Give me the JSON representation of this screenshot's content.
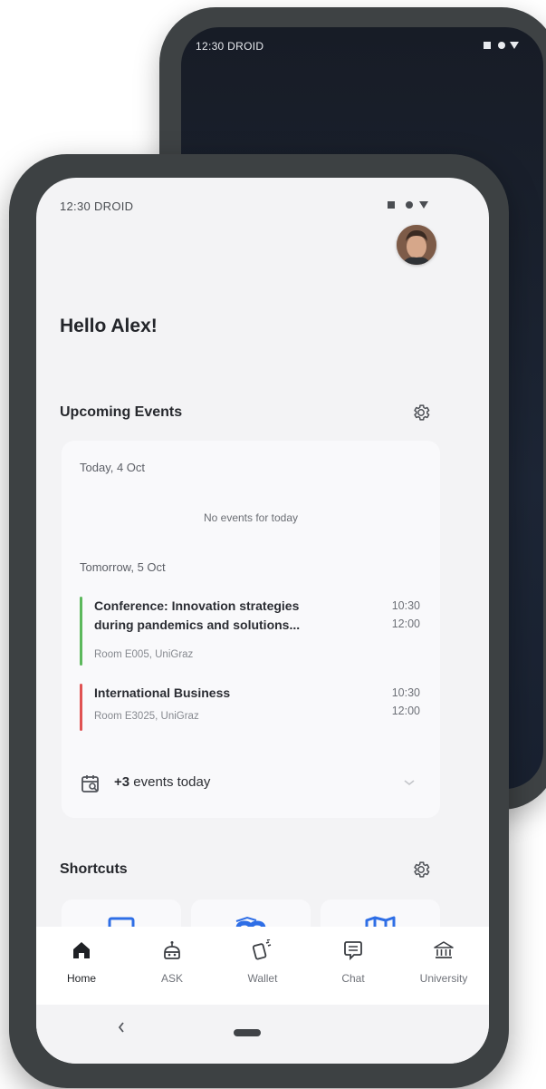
{
  "back_phone": {
    "time": "12:30 DROID"
  },
  "status_bar": {
    "time": "12:30 DROID"
  },
  "greeting": "Hello Alex!",
  "upcoming_events": {
    "title": "Upcoming Events",
    "today_label": "Today, 4 Oct",
    "no_events": "No events for today",
    "tomorrow_label": "Tomorrow, 5 Oct",
    "events": [
      {
        "title_line1": "Conference: Innovation strategies",
        "title_line2": "during pandemics and solutions...",
        "room": "Room E005, UniGraz",
        "start": "10:30",
        "end": "12:00",
        "color": "#5cb85c"
      },
      {
        "title_line1": "International Business",
        "room": "Room E3025, UniGraz",
        "start": "10:30",
        "end": "12:00",
        "color": "#e05252"
      }
    ],
    "more_count": "+3",
    "more_text": " events today"
  },
  "shortcuts": {
    "title": "Shortcuts"
  },
  "bottom_nav": {
    "items": [
      {
        "label": "Home",
        "icon": "home-icon",
        "active": true
      },
      {
        "label": "ASK",
        "icon": "robot-icon"
      },
      {
        "label": "Wallet",
        "icon": "wallet-cards-icon"
      },
      {
        "label": "Chat",
        "icon": "chat-icon"
      },
      {
        "label": "University",
        "icon": "university-icon"
      }
    ]
  },
  "colors": {
    "screen_bg": "#f3f3f5",
    "card_bg": "#f9f9fb",
    "accent_blue": "#2e6ee6",
    "text_dark": "#23252a"
  }
}
